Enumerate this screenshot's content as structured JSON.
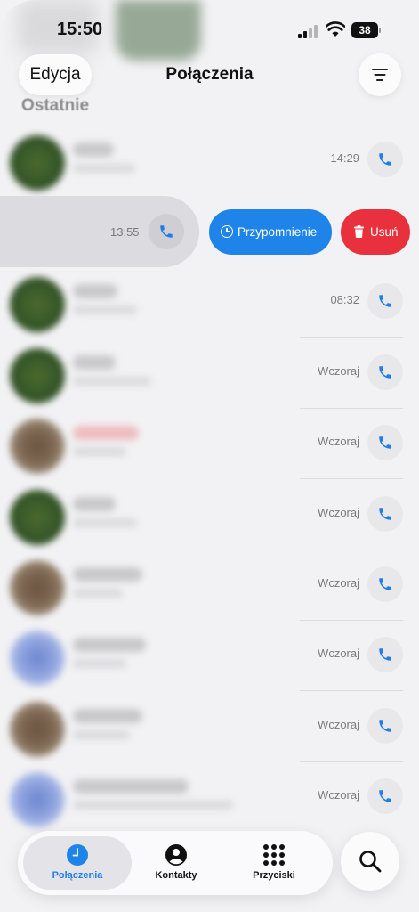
{
  "status_bar": {
    "time": "15:50",
    "battery": "38"
  },
  "header": {
    "edit_label": "Edycja",
    "title": "Połączenia",
    "section_title": "Ostatnie"
  },
  "colors": {
    "accent": "#1f84ea",
    "delete": "#e9303d",
    "background": "#f2f2f4"
  },
  "calls": [
    {
      "time": "14:29",
      "avatar": "green"
    },
    {
      "time": "13:55",
      "swiped": true
    },
    {
      "time": "08:32",
      "avatar": "green"
    },
    {
      "time": "Wczoraj",
      "avatar": "green"
    },
    {
      "time": "Wczoraj",
      "avatar": "brown"
    },
    {
      "time": "Wczoraj",
      "avatar": "green"
    },
    {
      "time": "Wczoraj",
      "avatar": "brown"
    },
    {
      "time": "Wczoraj",
      "avatar": "blue"
    },
    {
      "time": "Wczoraj",
      "avatar": "brown"
    },
    {
      "time": "Wczoraj",
      "avatar": "blue"
    }
  ],
  "swipe_actions": {
    "remind_label": "Przypomnienie",
    "delete_label": "Usuń"
  },
  "tabs": [
    {
      "label": "Połączenia",
      "icon": "clock-icon",
      "active": true
    },
    {
      "label": "Kontakty",
      "icon": "person-circle-icon",
      "active": false
    },
    {
      "label": "Przyciski",
      "icon": "keypad-icon",
      "active": false
    }
  ],
  "search_icon": "search-icon"
}
